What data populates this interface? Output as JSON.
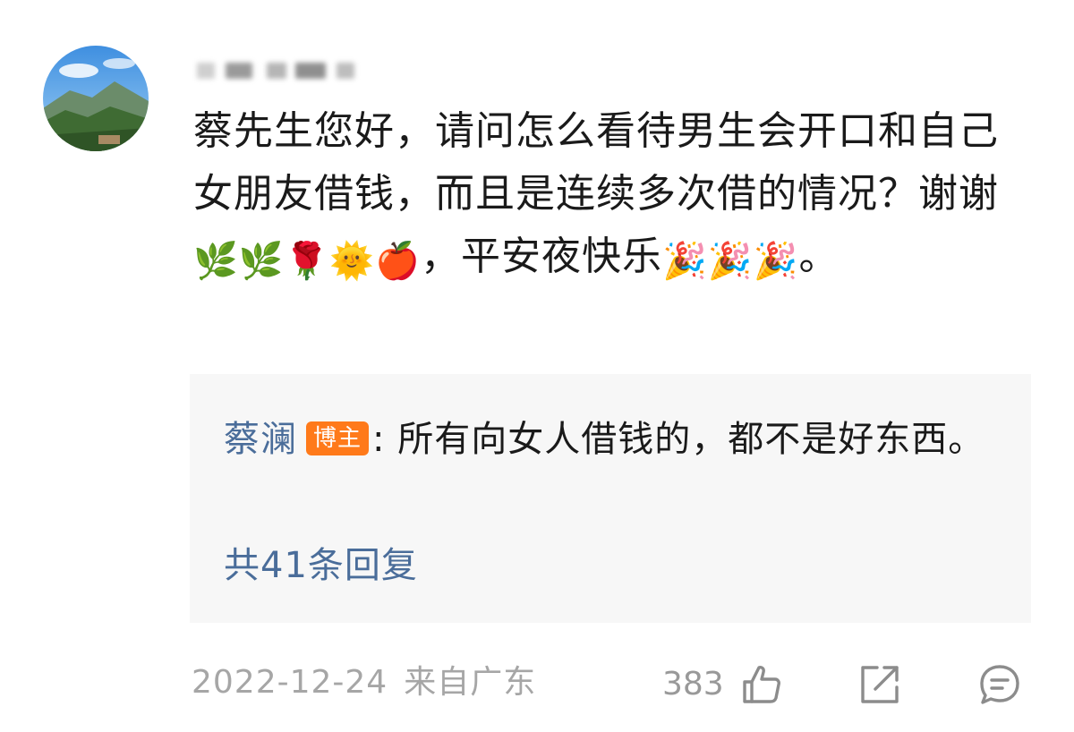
{
  "comment": {
    "avatar_icon": "landscape-avatar",
    "text_before_emoji": "蔡先生您好，请问怎么看待男生会开口和自己女朋友借钱，而且是连续多次借的情况？谢谢",
    "emoji_group_1": "🌿🌿🌹🌞🍎",
    "text_middle": "，平安夜快乐",
    "emoji_group_2": "🎉🎉🎉",
    "text_end": "。",
    "date": "2022-12-24",
    "location": "来自广东",
    "like_count": "383"
  },
  "reply": {
    "author": "蔡澜",
    "badge": "博主",
    "text": ": 所有向女人借钱的，都不是好东西。",
    "total_replies": "共41条回复"
  },
  "icons": {
    "like": "thumbs-up-icon",
    "share": "share-icon",
    "comment": "comment-icon"
  },
  "colors": {
    "link_blue": "#4a6d9a",
    "badge_orange": "#ff7a1a",
    "meta_gray": "#a6a6a6",
    "reply_bg": "#f7f7f7"
  }
}
